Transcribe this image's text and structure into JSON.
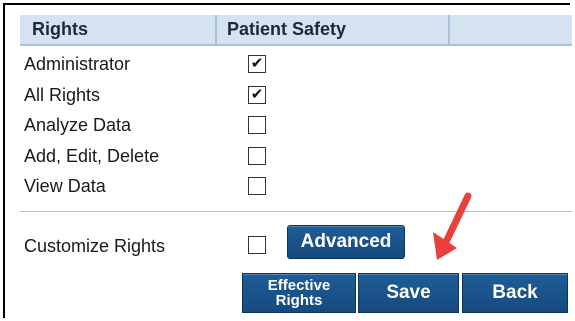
{
  "table": {
    "header": {
      "rights": "Rights",
      "patient_safety": "Patient Safety"
    },
    "rows": [
      {
        "label": "Administrator",
        "checked": true
      },
      {
        "label": "All Rights",
        "checked": true
      },
      {
        "label": "Analyze Data",
        "checked": false
      },
      {
        "label": "Add, Edit, Delete",
        "checked": false
      },
      {
        "label": "View Data",
        "checked": false
      }
    ]
  },
  "customize": {
    "label": "Customize Rights",
    "checked": false
  },
  "buttons": {
    "advanced": "Advanced",
    "effective_rights_line1": "Effective",
    "effective_rights_line2": "Rights",
    "save": "Save",
    "back": "Back"
  },
  "colors": {
    "header_bg": "#d5e3f1",
    "button_bg": "#1a5489",
    "arrow": "#e8403a"
  }
}
